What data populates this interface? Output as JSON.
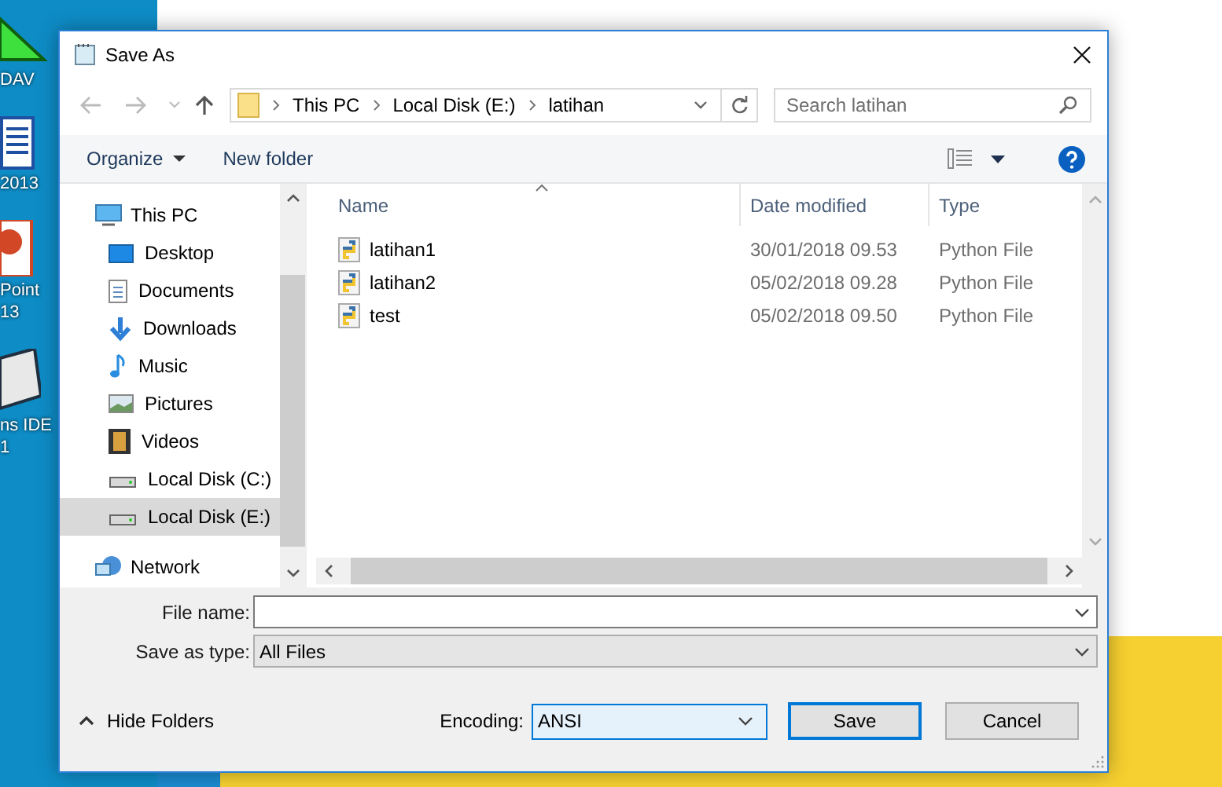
{
  "desktop": {
    "icons": [
      {
        "kind": "triangle",
        "lines": [
          "DAV"
        ]
      },
      {
        "kind": "document",
        "lines": [
          "2013"
        ]
      },
      {
        "kind": "slides",
        "lines": [
          "Point",
          "13"
        ]
      },
      {
        "kind": "box",
        "lines": [
          "ns IDE",
          "1"
        ]
      }
    ]
  },
  "window": {
    "title": "Save As"
  },
  "address_bar": {
    "breadcrumb": [
      "This PC",
      "Local Disk (E:)",
      "latihan"
    ]
  },
  "search": {
    "placeholder": "Search latihan"
  },
  "toolbar": {
    "buttons": [
      "Organize",
      "New folder"
    ]
  },
  "sidebar": {
    "items": [
      {
        "label": "This PC",
        "kind": "pc",
        "selected": false,
        "children": [
          {
            "label": "Desktop",
            "kind": "desktop",
            "selected": false
          },
          {
            "label": "Documents",
            "kind": "documents",
            "selected": false
          },
          {
            "label": "Downloads",
            "kind": "downloads",
            "selected": false
          },
          {
            "label": "Music",
            "kind": "music",
            "selected": false
          },
          {
            "label": "Pictures",
            "kind": "pictures",
            "selected": false
          },
          {
            "label": "Videos",
            "kind": "videos",
            "selected": false
          },
          {
            "label": "Local Disk (C:)",
            "kind": "drive",
            "selected": false
          },
          {
            "label": "Local Disk (E:)",
            "kind": "drive",
            "selected": true
          }
        ]
      },
      {
        "label": "Network",
        "kind": "network",
        "selected": false
      }
    ]
  },
  "table": {
    "columns": [
      "Name",
      "Date modified",
      "Type"
    ],
    "rows": [
      {
        "name": "latihan1",
        "date": "30/01/2018 09.53",
        "type": "Python File"
      },
      {
        "name": "latihan2",
        "date": "05/02/2018 09.28",
        "type": "Python File"
      },
      {
        "name": "test",
        "date": "05/02/2018 09.50",
        "type": "Python File"
      }
    ]
  },
  "form": {
    "fields": [
      {
        "label": "File name:",
        "kind": "text"
      },
      {
        "label": "Save as type:",
        "kind": "select",
        "value": "All Files"
      }
    ]
  },
  "footer": {
    "hide_folders": "Hide Folders",
    "encoding_label": "Encoding:",
    "encoding_value": "ANSI",
    "buttons": [
      {
        "label": "Save",
        "default": true
      },
      {
        "label": "Cancel",
        "default": false
      }
    ]
  }
}
